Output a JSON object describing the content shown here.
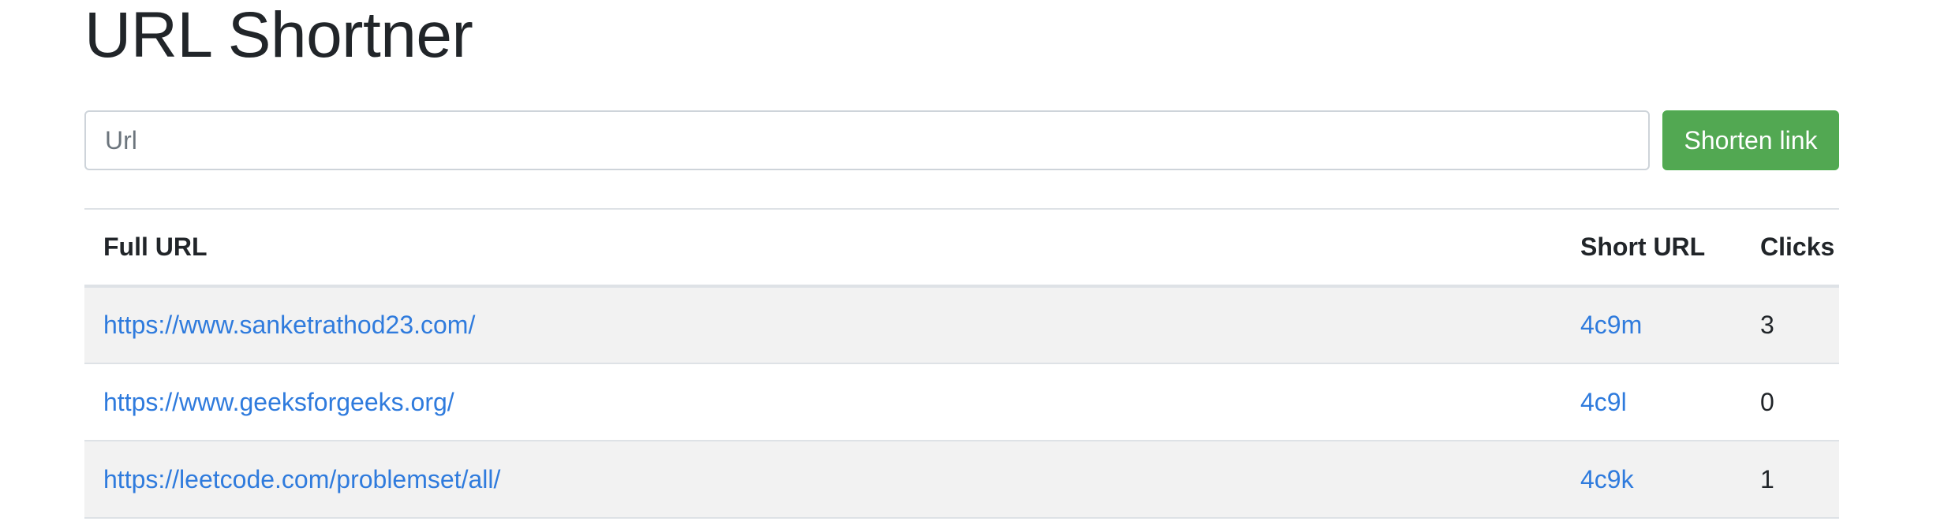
{
  "app": {
    "title": "URL Shortner"
  },
  "form": {
    "url_placeholder": "Url",
    "url_value": "",
    "submit_label": "Shorten link",
    "submit_color": "#52a852"
  },
  "table": {
    "headers": {
      "full_url": "Full URL",
      "short_url": "Short URL",
      "clicks": "Clicks"
    },
    "rows": [
      {
        "full_url": "https://www.sanketrathod23.com/",
        "short_url": "4c9m",
        "clicks": "3"
      },
      {
        "full_url": "https://www.geeksforgeeks.org/",
        "short_url": "4c9l",
        "clicks": "0"
      },
      {
        "full_url": "https://leetcode.com/problemset/all/",
        "short_url": "4c9k",
        "clicks": "1"
      }
    ]
  },
  "colors": {
    "link": "#2f7bdd",
    "stripe": "#f2f2f2",
    "border": "#dee2e6"
  }
}
